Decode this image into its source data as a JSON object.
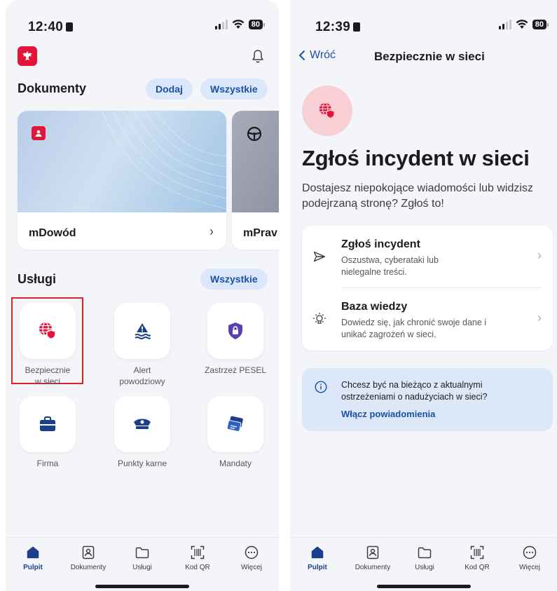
{
  "left_screen": {
    "status": {
      "time": "12:40",
      "battery": "80"
    },
    "documents": {
      "title": "Dokumenty",
      "add_label": "Dodaj",
      "all_label": "Wszystkie",
      "cards": [
        {
          "name": "mDowód"
        },
        {
          "name": "mPrav"
        }
      ]
    },
    "services": {
      "title": "Usługi",
      "all_label": "Wszystkie",
      "items": [
        {
          "label": "Bezpiecznie w sieci",
          "icon": "globe-shield-icon"
        },
        {
          "label": "Alert powodziowy",
          "icon": "flood-alert-icon"
        },
        {
          "label": "Zastrzeż PESEL",
          "icon": "shield-lock-icon"
        },
        {
          "label": "Firma",
          "icon": "briefcase-icon"
        },
        {
          "label": "Punkty karne",
          "icon": "police-cap-icon"
        },
        {
          "label": "Mandaty",
          "icon": "tickets-icon"
        }
      ]
    }
  },
  "right_screen": {
    "status": {
      "time": "12:39",
      "battery": "80"
    },
    "nav": {
      "back_label": "Wróć",
      "title": "Bezpiecznie w sieci"
    },
    "hero": {
      "heading": "Zgłoś incydent w sieci",
      "description": "Dostajesz niepokojące wiadomości lub widzisz podejrzaną stronę? Zgłoś to!"
    },
    "options": [
      {
        "title": "Zgłoś incydent",
        "subtitle": "Oszustwa, cyberataki lub nielegalne treści.",
        "icon": "send-icon"
      },
      {
        "title": "Baza wiedzy",
        "subtitle": "Dowiedz się, jak chronić swoje dane i unikać zagrożeń w sieci.",
        "icon": "lightbulb-icon"
      }
    ],
    "info_box": {
      "text": "Chcesz być na bieżąco z aktualnymi ostrzeżeniami o nadużyciach w sieci?",
      "link": "Włącz powiadomienia"
    }
  },
  "tabbar": {
    "items": [
      {
        "label": "Pulpit",
        "icon": "home-icon",
        "active": true
      },
      {
        "label": "Dokumenty",
        "icon": "id-card-icon",
        "active": false
      },
      {
        "label": "Usługi",
        "icon": "folder-icon",
        "active": false
      },
      {
        "label": "Kod QR",
        "icon": "qr-scan-icon",
        "active": false
      },
      {
        "label": "Więcej",
        "icon": "more-icon",
        "active": false
      }
    ]
  },
  "colors": {
    "accent_blue": "#1c3f8a",
    "pill_bg": "#dbe7fa",
    "brand_red": "#e3133a",
    "highlight_border": "#e0202a",
    "info_bg": "#dce8f7"
  }
}
